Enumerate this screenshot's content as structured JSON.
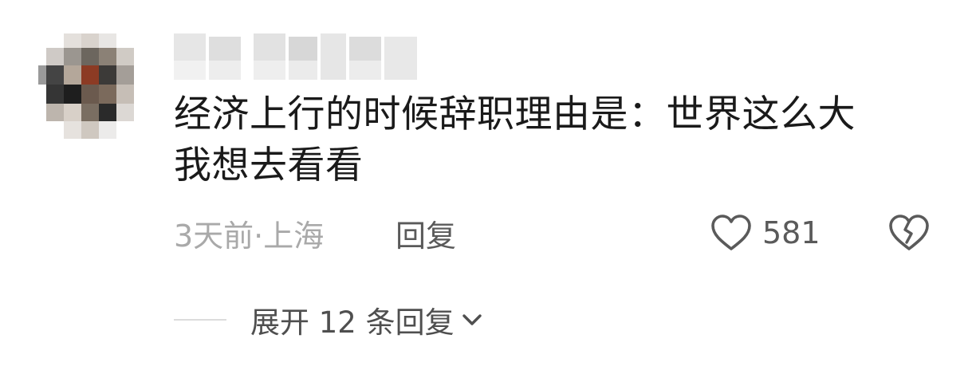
{
  "comment": {
    "text": "经济上行的时候辞职理由是：世界这么大\n我想去看看",
    "meta": "3天前·上海",
    "reply_label": "回复",
    "like_count": "581"
  },
  "expand": {
    "label": "展开 12 条回复"
  },
  "icons": {
    "like": "heart-outline-icon",
    "dislike": "broken-heart-icon",
    "expand": "chevron-down-icon"
  },
  "colors": {
    "text_primary": "#1a1a1a",
    "text_meta": "#a9a9a9",
    "text_action": "#5a5a5a",
    "divider": "#dcdcdc"
  }
}
